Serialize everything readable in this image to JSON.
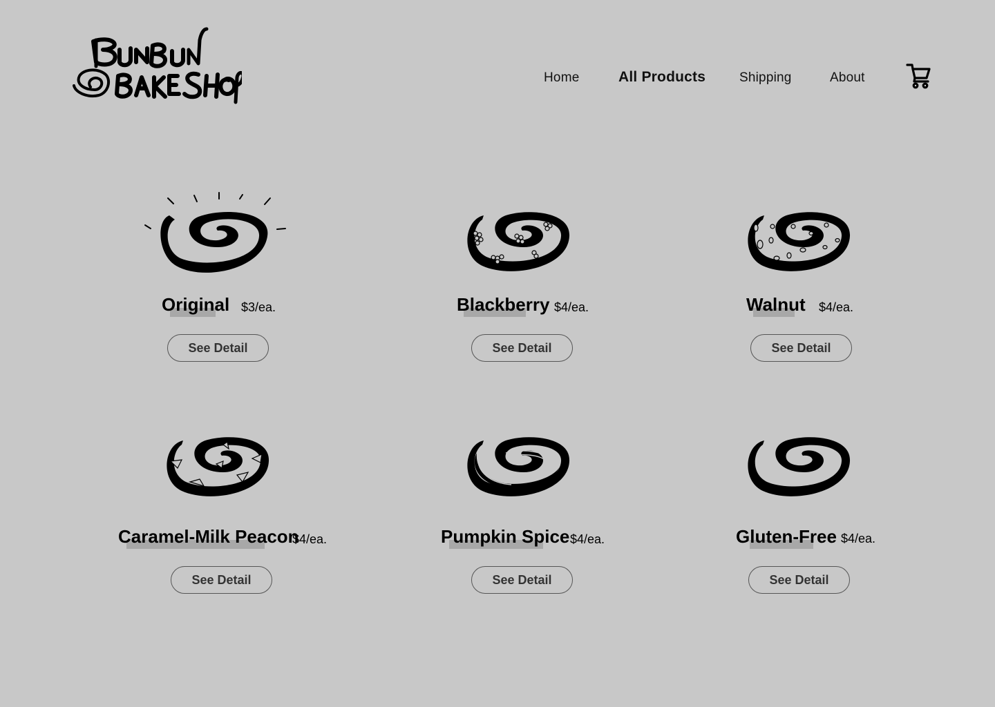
{
  "brand": {
    "logo_text_line1": "BUNBUN",
    "logo_text_line2": "BAKE SHOP"
  },
  "nav": {
    "items": [
      {
        "label": "Home",
        "active": false
      },
      {
        "label": "All Products",
        "active": true
      },
      {
        "label": "Shipping",
        "active": false
      },
      {
        "label": "About",
        "active": false
      }
    ],
    "cart_icon": "shopping-cart-icon"
  },
  "products": [
    {
      "name": "Original",
      "price": "$3/ea.",
      "button": "See Detail",
      "icon": "cinnamon-roll-glowing-icon"
    },
    {
      "name": "Blackberry",
      "price": "$4/ea.",
      "button": "See Detail",
      "icon": "cinnamon-roll-blackberry-icon"
    },
    {
      "name": "Walnut",
      "price": "$4/ea.",
      "button": "See Detail",
      "icon": "cinnamon-roll-walnut-icon"
    },
    {
      "name": "Caramel-Milk Peacon",
      "price": "$4/ea.",
      "button": "See Detail",
      "icon": "cinnamon-roll-pecan-icon"
    },
    {
      "name": "Pumpkin Spice",
      "price": "$4/ea.",
      "button": "See Detail",
      "icon": "cinnamon-roll-pumpkin-icon"
    },
    {
      "name": "Gluten-Free",
      "price": "$4/ea.",
      "button": "See Detail",
      "icon": "cinnamon-roll-plain-icon"
    }
  ],
  "colors": {
    "background": "#c8c8c8",
    "highlight": "#a8a8a8",
    "ink": "#000000",
    "button_border": "#555555"
  }
}
